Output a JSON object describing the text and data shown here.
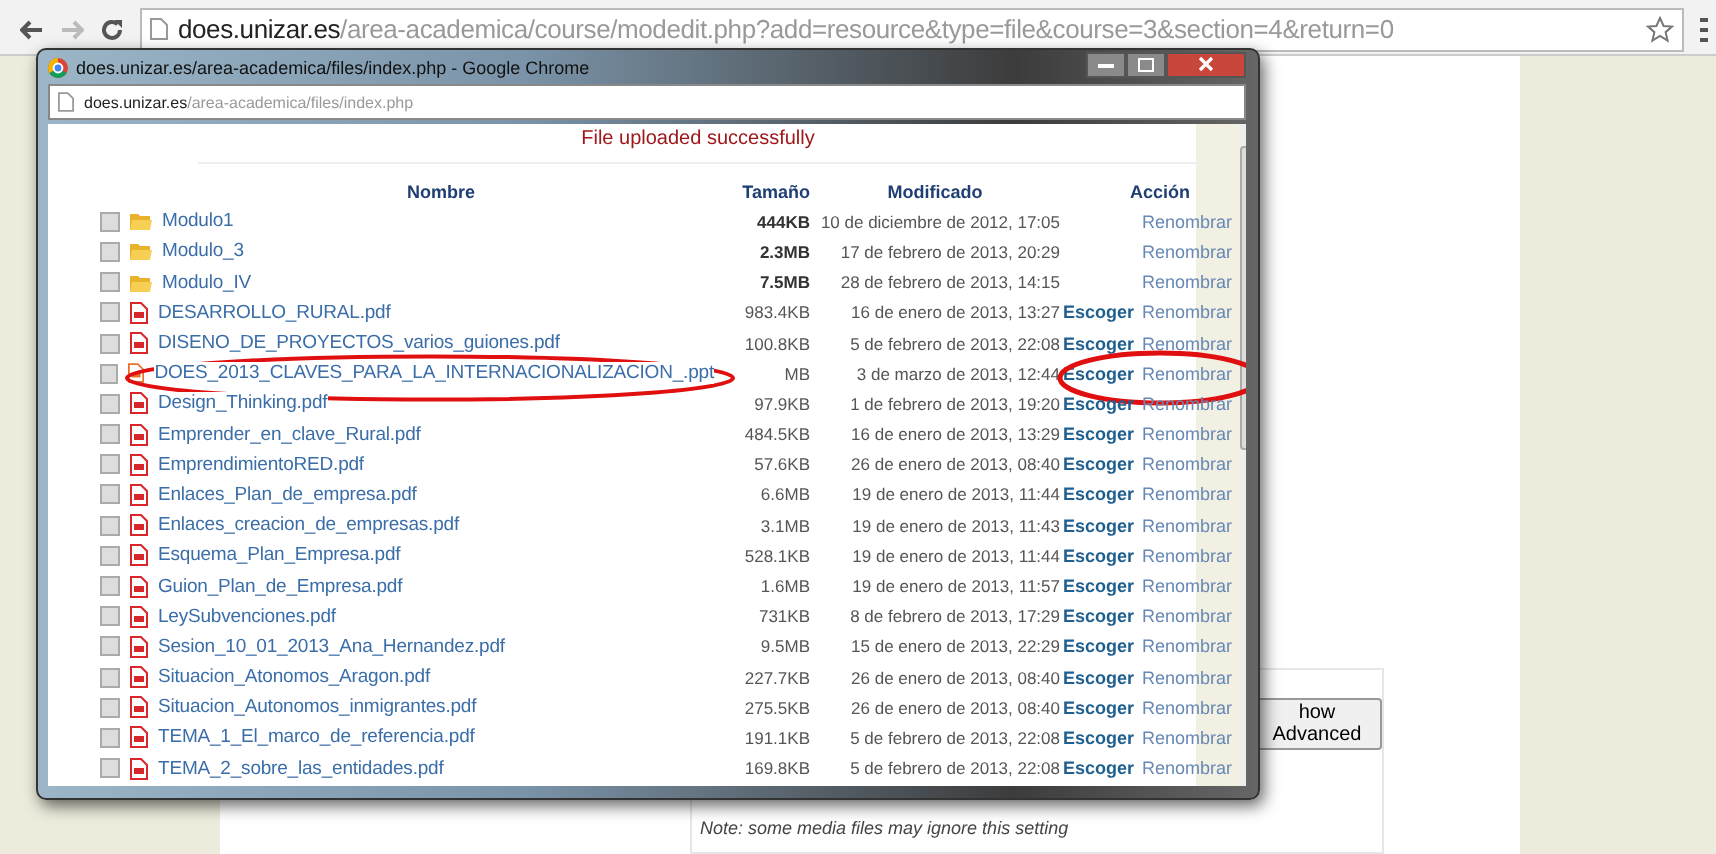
{
  "browser": {
    "url_domain": "does.unizar.es",
    "url_path": "/area-academica/course/modedit.php?add=resource&type=file&course=3&section=4&return=0"
  },
  "background_page": {
    "button": "how Advanced",
    "note": "Note: some media files may ignore this setting"
  },
  "popup": {
    "title": "does.unizar.es/area-academica/files/index.php - Google Chrome",
    "url_domain": "does.unizar.es",
    "url_path": "/area-academica/files/index.php",
    "message": "File uploaded successfully",
    "columns": [
      "Nombre",
      "Tamaño",
      "Modificado",
      "Acción"
    ],
    "rows": [
      {
        "kind": "folder",
        "name": "Modulo1",
        "size": "444KB",
        "modified": "10 de diciembre de 2012, 17:05",
        "rename": "Renombrar",
        "checked": false
      },
      {
        "kind": "folder",
        "name": "Modulo_3",
        "size": "2.3MB",
        "modified": "17 de febrero de 2013, 20:29",
        "rename": "Renombrar",
        "checked": false
      },
      {
        "kind": "folder",
        "name": "Modulo_IV",
        "size": "7.5MB",
        "modified": "28 de febrero de 2013, 14:15",
        "rename": "Renombrar",
        "checked": false
      },
      {
        "kind": "pdf",
        "name": "DESARROLLO_RURAL.pdf",
        "size": "983.4KB",
        "modified": "16 de enero de 2013, 13:27",
        "choose": "Escoger",
        "rename": "Renombrar",
        "checked": false
      },
      {
        "kind": "pdf",
        "name": "DISENO_DE_PROYECTOS_varios_guiones.pdf",
        "size": "100.8KB",
        "modified": "5 de febrero de 2013, 22:08",
        "choose": "Escoger",
        "rename": "Renombrar",
        "checked": false
      },
      {
        "kind": "ppt",
        "name": "DOES_2013_CLAVES_PARA_LA_INTERNACIONALIZACION_.ppt",
        "size": "MB",
        "modified": "3 de marzo de 2013, 12:44",
        "choose": "Escoger",
        "rename": "Renombrar",
        "checked": false,
        "circled": true
      },
      {
        "kind": "pdf",
        "name": "Design_Thinking.pdf",
        "size": "97.9KB",
        "modified": "1 de febrero de 2013, 19:20",
        "choose": "Escoger",
        "rename": "Renombrar",
        "checked": false
      },
      {
        "kind": "pdf",
        "name": "Emprender_en_clave_Rural.pdf",
        "size": "484.5KB",
        "modified": "16 de enero de 2013, 13:29",
        "choose": "Escoger",
        "rename": "Renombrar",
        "checked": false
      },
      {
        "kind": "pdf",
        "name": "EmprendimientoRED.pdf",
        "size": "57.6KB",
        "modified": "26 de enero de 2013, 08:40",
        "choose": "Escoger",
        "rename": "Renombrar",
        "checked": false
      },
      {
        "kind": "pdf",
        "name": "Enlaces_Plan_de_empresa.pdf",
        "size": "6.6MB",
        "modified": "19 de enero de 2013, 11:44",
        "choose": "Escoger",
        "rename": "Renombrar",
        "checked": false
      },
      {
        "kind": "pdf",
        "name": "Enlaces_creacion_de_empresas.pdf",
        "size": "3.1MB",
        "modified": "19 de enero de 2013, 11:43",
        "choose": "Escoger",
        "rename": "Renombrar",
        "checked": false
      },
      {
        "kind": "pdf",
        "name": "Esquema_Plan_Empresa.pdf",
        "size": "528.1KB",
        "modified": "19 de enero de 2013, 11:44",
        "choose": "Escoger",
        "rename": "Renombrar",
        "checked": false
      },
      {
        "kind": "pdf",
        "name": "Guion_Plan_de_Empresa.pdf",
        "size": "1.6MB",
        "modified": "19 de enero de 2013, 11:57",
        "choose": "Escoger",
        "rename": "Renombrar",
        "checked": false
      },
      {
        "kind": "pdf",
        "name": "LeySubvenciones.pdf",
        "size": "731KB",
        "modified": "8 de febrero de 2013, 17:29",
        "choose": "Escoger",
        "rename": "Renombrar",
        "checked": false
      },
      {
        "kind": "pdf",
        "name": "Sesion_10_01_2013_Ana_Hernandez.pdf",
        "size": "9.5MB",
        "modified": "15 de enero de 2013, 22:29",
        "choose": "Escoger",
        "rename": "Renombrar",
        "checked": false
      },
      {
        "kind": "pdf",
        "name": "Situacion_Atonomos_Aragon.pdf",
        "size": "227.7KB",
        "modified": "26 de enero de 2013, 08:40",
        "choose": "Escoger",
        "rename": "Renombrar",
        "checked": false
      },
      {
        "kind": "pdf",
        "name": "Situacion_Autonomos_inmigrantes.pdf",
        "size": "275.5KB",
        "modified": "26 de enero de 2013, 08:40",
        "choose": "Escoger",
        "rename": "Renombrar",
        "checked": false
      },
      {
        "kind": "pdf",
        "name": "TEMA_1_El_marco_de_referencia.pdf",
        "size": "191.1KB",
        "modified": "5 de febrero de 2013, 22:08",
        "choose": "Escoger",
        "rename": "Renombrar",
        "checked": false
      },
      {
        "kind": "pdf",
        "name": "TEMA_2_sobre_las_entidades.pdf",
        "size": "169.8KB",
        "modified": "5 de febrero de 2013, 22:08",
        "choose": "Escoger",
        "rename": "Renombrar",
        "checked": false
      }
    ]
  }
}
